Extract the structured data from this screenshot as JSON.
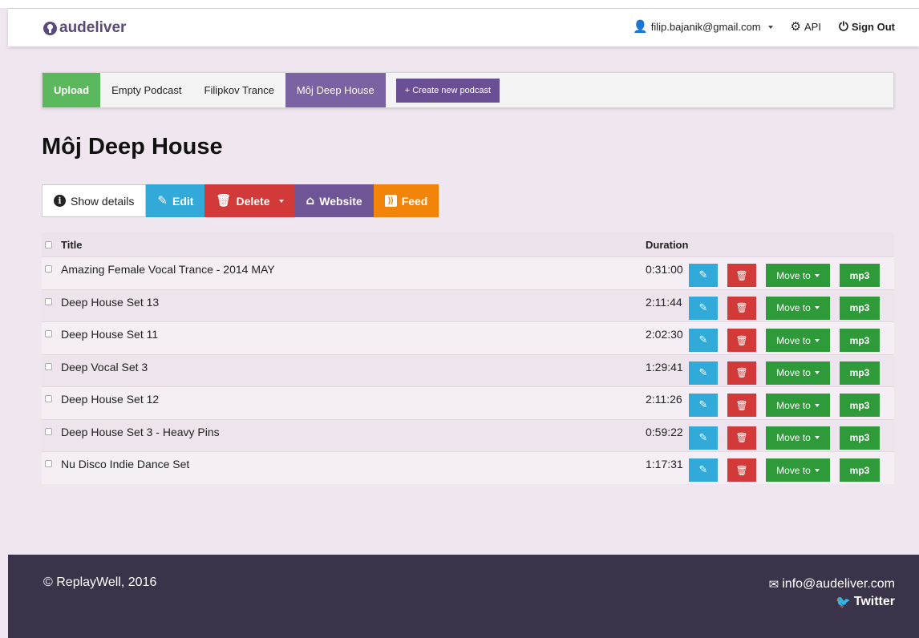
{
  "navbar": {
    "brand": "audeliver",
    "user": "filip.bajanik@gmail.com",
    "api": "API",
    "signout": "Sign Out"
  },
  "podcast_tabs": {
    "upload": "Upload",
    "tabs": [
      "Empty Podcast",
      "Filipkov Trance",
      "Môj Deep House"
    ],
    "active": "Môj Deep House",
    "create": "+ Create new podcast"
  },
  "page": {
    "title": "Môj Deep House"
  },
  "actions": {
    "details": "Show details",
    "edit": "Edit",
    "delete": "Delete",
    "website": "Website",
    "feed": "Feed"
  },
  "table": {
    "headers": {
      "title": "Title",
      "duration": "Duration"
    },
    "rows": [
      {
        "title": "Amazing Female Vocal Trance - 2014 MAY",
        "duration": "0:31:00"
      },
      {
        "title": "Deep House Set 13",
        "duration": "2:11:44"
      },
      {
        "title": "Deep House Set 11",
        "duration": "2:02:30"
      },
      {
        "title": "Deep Vocal Set 3",
        "duration": "1:29:41"
      },
      {
        "title": "Deep House Set 12",
        "duration": "2:11:26"
      },
      {
        "title": "Deep House Set 3 - Heavy Pins",
        "duration": "0:59:22"
      },
      {
        "title": "Nu Disco Indie Dance Set",
        "duration": "1:17:31"
      }
    ],
    "move_label": "Move to",
    "mp3_label": "mp3"
  },
  "footer": {
    "copyright": "© ReplayWell, 2016",
    "email": "info@audeliver.com",
    "twitter": "Twitter"
  },
  "colors": {
    "brand": "#5b4a78",
    "upload": "#5cb85c",
    "active_tab": "#7a62a3",
    "edit": "#31a9d9",
    "delete": "#d23a3a",
    "website": "#6f5596",
    "feed": "#f2840a",
    "green": "#2e9a3a",
    "footer": "#3b3349"
  },
  "icons": [
    "podcast-logo-icon",
    "user-icon",
    "gear-icon",
    "power-icon",
    "info-icon",
    "pencil-icon",
    "trash-icon",
    "home-icon",
    "rss-icon",
    "envelope-icon",
    "twitter-icon"
  ]
}
